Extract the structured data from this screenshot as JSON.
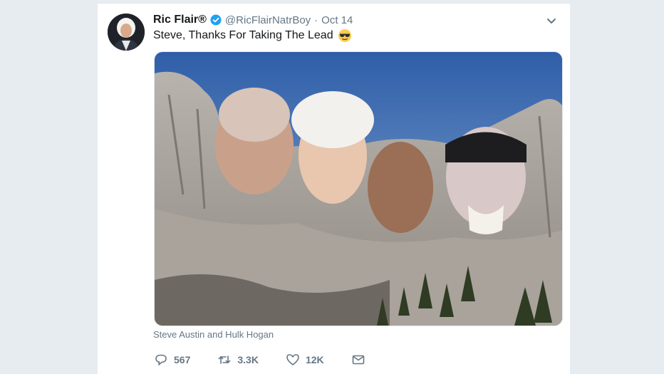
{
  "tweet": {
    "author_name": "Ric Flair®",
    "verified_icon": "verified-badge-icon",
    "handle": "@RicFlairNatrBoy",
    "separator": "·",
    "date": "Oct 14",
    "text": "Steve, Thanks For Taking The Lead",
    "emoji_icon": "sunglasses-emoji-icon",
    "tagged_people": "Steve Austin and Hulk Hogan"
  },
  "actions": {
    "replies": "567",
    "retweets": "3.3K",
    "likes": "12K"
  },
  "colors": {
    "background": "#e6ecf0",
    "card": "#ffffff",
    "muted_text": "#657786",
    "primary_text": "#14171a",
    "verified_blue": "#1da1f2"
  }
}
